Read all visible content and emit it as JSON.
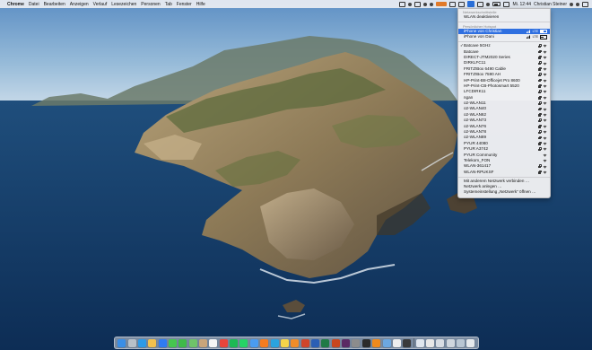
{
  "menubar": {
    "apple": "",
    "app_name": "Chrome",
    "items": [
      "Datei",
      "Bearbeiten",
      "Anzeigen",
      "Verlauf",
      "Lesezeichen",
      "Personen",
      "Tab",
      "Fenster",
      "Hilfe"
    ],
    "clock": "Mi. 12:44",
    "user": "Christian Steiner",
    "status_icons": [
      "dropbox-icon",
      "timemachine-icon",
      "screen-icon",
      "volume-icon",
      "bluetooth-icon",
      "orange-app-icon",
      "display-icon",
      "mail-icon",
      "wifi-icon",
      "cast-icon",
      "bluetooth-status-icon",
      "battery-icon",
      "keyboard-icon",
      "search-icon",
      "siri-icon",
      "notification-center-icon"
    ]
  },
  "wifi_menu": {
    "header_interface": "Netzwerkschnittstelle",
    "toggle_label": "WLAN deaktivieren",
    "hotspot_header": "Persönlicher Hotspot",
    "hotspots": [
      {
        "name": "iPhone von Christian",
        "badge": "LTE",
        "highlight": true
      },
      {
        "name": "iPhone von Dani",
        "badge": "LTE",
        "highlight": false
      }
    ],
    "networks": [
      {
        "name": "Batcave 5GHz",
        "checked": true,
        "lock": true
      },
      {
        "name": "Batcave",
        "checked": false,
        "lock": true
      },
      {
        "name": "DIRECT-JTM2020 Series",
        "checked": false,
        "lock": true
      },
      {
        "name": "DIRKLFC11",
        "checked": false,
        "lock": true
      },
      {
        "name": "FRITZ!Box 6490 Cable",
        "checked": false,
        "lock": true
      },
      {
        "name": "FRITZ!Box 7590 AH",
        "checked": false,
        "lock": true
      },
      {
        "name": "HP-Print-B8-Officejet Pro 8600",
        "checked": false,
        "lock": true
      },
      {
        "name": "HP-Print-CB-Photosmart 5520",
        "checked": false,
        "lock": true
      },
      {
        "name": "LFCDIRK11",
        "checked": false,
        "lock": true
      },
      {
        "name": "ngan",
        "checked": false,
        "lock": true
      },
      {
        "name": "o2-WLAN11",
        "checked": false,
        "lock": true
      },
      {
        "name": "o2-WLAN40",
        "checked": false,
        "lock": true
      },
      {
        "name": "o2-WLAN62",
        "checked": false,
        "lock": true
      },
      {
        "name": "o2-WLAN73",
        "checked": false,
        "lock": true
      },
      {
        "name": "o2-WLAN76",
        "checked": false,
        "lock": true
      },
      {
        "name": "o2-WLAN78",
        "checked": false,
        "lock": true
      },
      {
        "name": "o2-WLAN89",
        "checked": false,
        "lock": true
      },
      {
        "name": "PYUR 44080",
        "checked": false,
        "lock": true
      },
      {
        "name": "PYUR A3742",
        "checked": false,
        "lock": true
      },
      {
        "name": "PYUR Community",
        "checked": false,
        "lock": false
      },
      {
        "name": "Telekom_FON",
        "checked": false,
        "lock": false
      },
      {
        "name": "WLAN-361417",
        "checked": false,
        "lock": true
      },
      {
        "name": "WLAN-RPUKSF",
        "checked": false,
        "lock": true
      }
    ],
    "other_network": "Mit anderem Netzwerk verbinden …",
    "create_network": "Netzwerk anlegen …",
    "preferences": "Systemeinstellung „Netzwerk“ öffnen …"
  },
  "dock": {
    "apps": [
      {
        "name": "finder-icon",
        "color": "#3a8ee6"
      },
      {
        "name": "launchpad-icon",
        "color": "#b8c0c8"
      },
      {
        "name": "safari-icon",
        "color": "#2d9ae8"
      },
      {
        "name": "photos-icon",
        "color": "#f2c14e"
      },
      {
        "name": "app-store-icon",
        "color": "#2f7bf2"
      },
      {
        "name": "messages-icon",
        "color": "#46c64f"
      },
      {
        "name": "facetime-icon",
        "color": "#3fba4a"
      },
      {
        "name": "maps-icon",
        "color": "#6fc36a"
      },
      {
        "name": "contacts-icon",
        "color": "#c9a57a"
      },
      {
        "name": "calendar-icon",
        "color": "#f5f5f5"
      },
      {
        "name": "chrome-icon",
        "color": "#e8453c"
      },
      {
        "name": "spotify-icon",
        "color": "#1db954"
      },
      {
        "name": "whatsapp-icon",
        "color": "#25d366"
      },
      {
        "name": "mail-icon",
        "color": "#4a9cf0"
      },
      {
        "name": "firefox-icon",
        "color": "#f57c1f"
      },
      {
        "name": "telegram-icon",
        "color": "#2aa3df"
      },
      {
        "name": "notes-icon",
        "color": "#f7d54a"
      },
      {
        "name": "books-icon",
        "color": "#f08c2a"
      },
      {
        "name": "office-icon",
        "color": "#d0452b"
      },
      {
        "name": "word-icon",
        "color": "#2b5fb4"
      },
      {
        "name": "excel-icon",
        "color": "#1f7a45"
      },
      {
        "name": "powerpoint-icon",
        "color": "#c8461f"
      },
      {
        "name": "slack-icon",
        "color": "#5b2a63"
      },
      {
        "name": "system-preferences-icon",
        "color": "#8c8c8c"
      },
      {
        "name": "terminal-icon",
        "color": "#2b2b2b"
      },
      {
        "name": "vlc-icon",
        "color": "#f08a1d"
      },
      {
        "name": "preview-icon",
        "color": "#6ca7e0"
      },
      {
        "name": "textedit-icon",
        "color": "#eeeeee"
      },
      {
        "name": "activity-monitor-icon",
        "color": "#3a3a3a"
      }
    ],
    "stack_items": [
      {
        "name": "downloads-stack-icon",
        "color": "#dfe6ee"
      },
      {
        "name": "documents-stack-icon",
        "color": "#e8e8e8"
      },
      {
        "name": "applications-stack-icon",
        "color": "#d8dde4"
      },
      {
        "name": "screenshots-stack-icon",
        "color": "#cfd6de"
      },
      {
        "name": "folder-stack-icon",
        "color": "#b9c6d3"
      },
      {
        "name": "trash-icon",
        "color": "#e6e9ec"
      }
    ]
  }
}
